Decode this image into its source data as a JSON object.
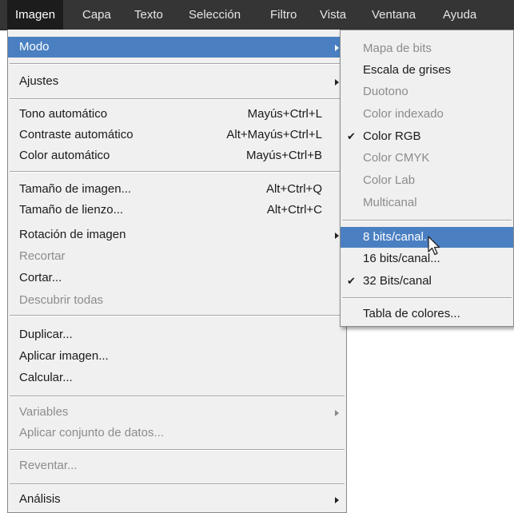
{
  "menubar": {
    "items": [
      "Imagen",
      "Capa",
      "Texto",
      "Selección",
      "Filtro",
      "Vista",
      "Ventana",
      "Ayuda"
    ]
  },
  "image_menu": {
    "mode": "Modo",
    "adjustments": "Ajustes",
    "auto_tone": {
      "label": "Tono automático",
      "shortcut": "Mayús+Ctrl+L"
    },
    "auto_contrast": {
      "label": "Contraste automático",
      "shortcut": "Alt+Mayús+Ctrl+L"
    },
    "auto_color": {
      "label": "Color automático",
      "shortcut": "Mayús+Ctrl+B"
    },
    "image_size": {
      "label": "Tamaño de imagen...",
      "shortcut": "Alt+Ctrl+Q"
    },
    "canvas_size": {
      "label": "Tamaño de lienzo...",
      "shortcut": "Alt+Ctrl+C"
    },
    "image_rotation": "Rotación de imagen",
    "crop": "Recortar",
    "trim": "Cortar...",
    "reveal_all": "Descubrir todas",
    "duplicate": "Duplicar...",
    "apply_image": "Aplicar imagen...",
    "calculations": "Calcular...",
    "variables": "Variables",
    "apply_data_set": "Aplicar conjunto de datos...",
    "trap": "Reventar...",
    "analysis": "Análisis"
  },
  "mode_submenu": {
    "bitmap": "Mapa de bits",
    "grayscale": "Escala de grises",
    "duotone": "Duotono",
    "indexed_color": "Color indexado",
    "rgb_color": "Color RGB",
    "cmyk_color": "Color CMYK",
    "lab_color": "Color Lab",
    "multichannel": "Multicanal",
    "bits_8": "8 bits/canal...",
    "bits_16": "16 bits/canal...",
    "bits_32": "32 Bits/canal",
    "color_table": "Tabla de colores...",
    "check_glyph": "✔"
  },
  "colors": {
    "menubar_bg": "#353535",
    "menu_bg": "#f0f0f0",
    "highlight": "#4a80c2",
    "disabled_text": "#8c8c8c"
  }
}
